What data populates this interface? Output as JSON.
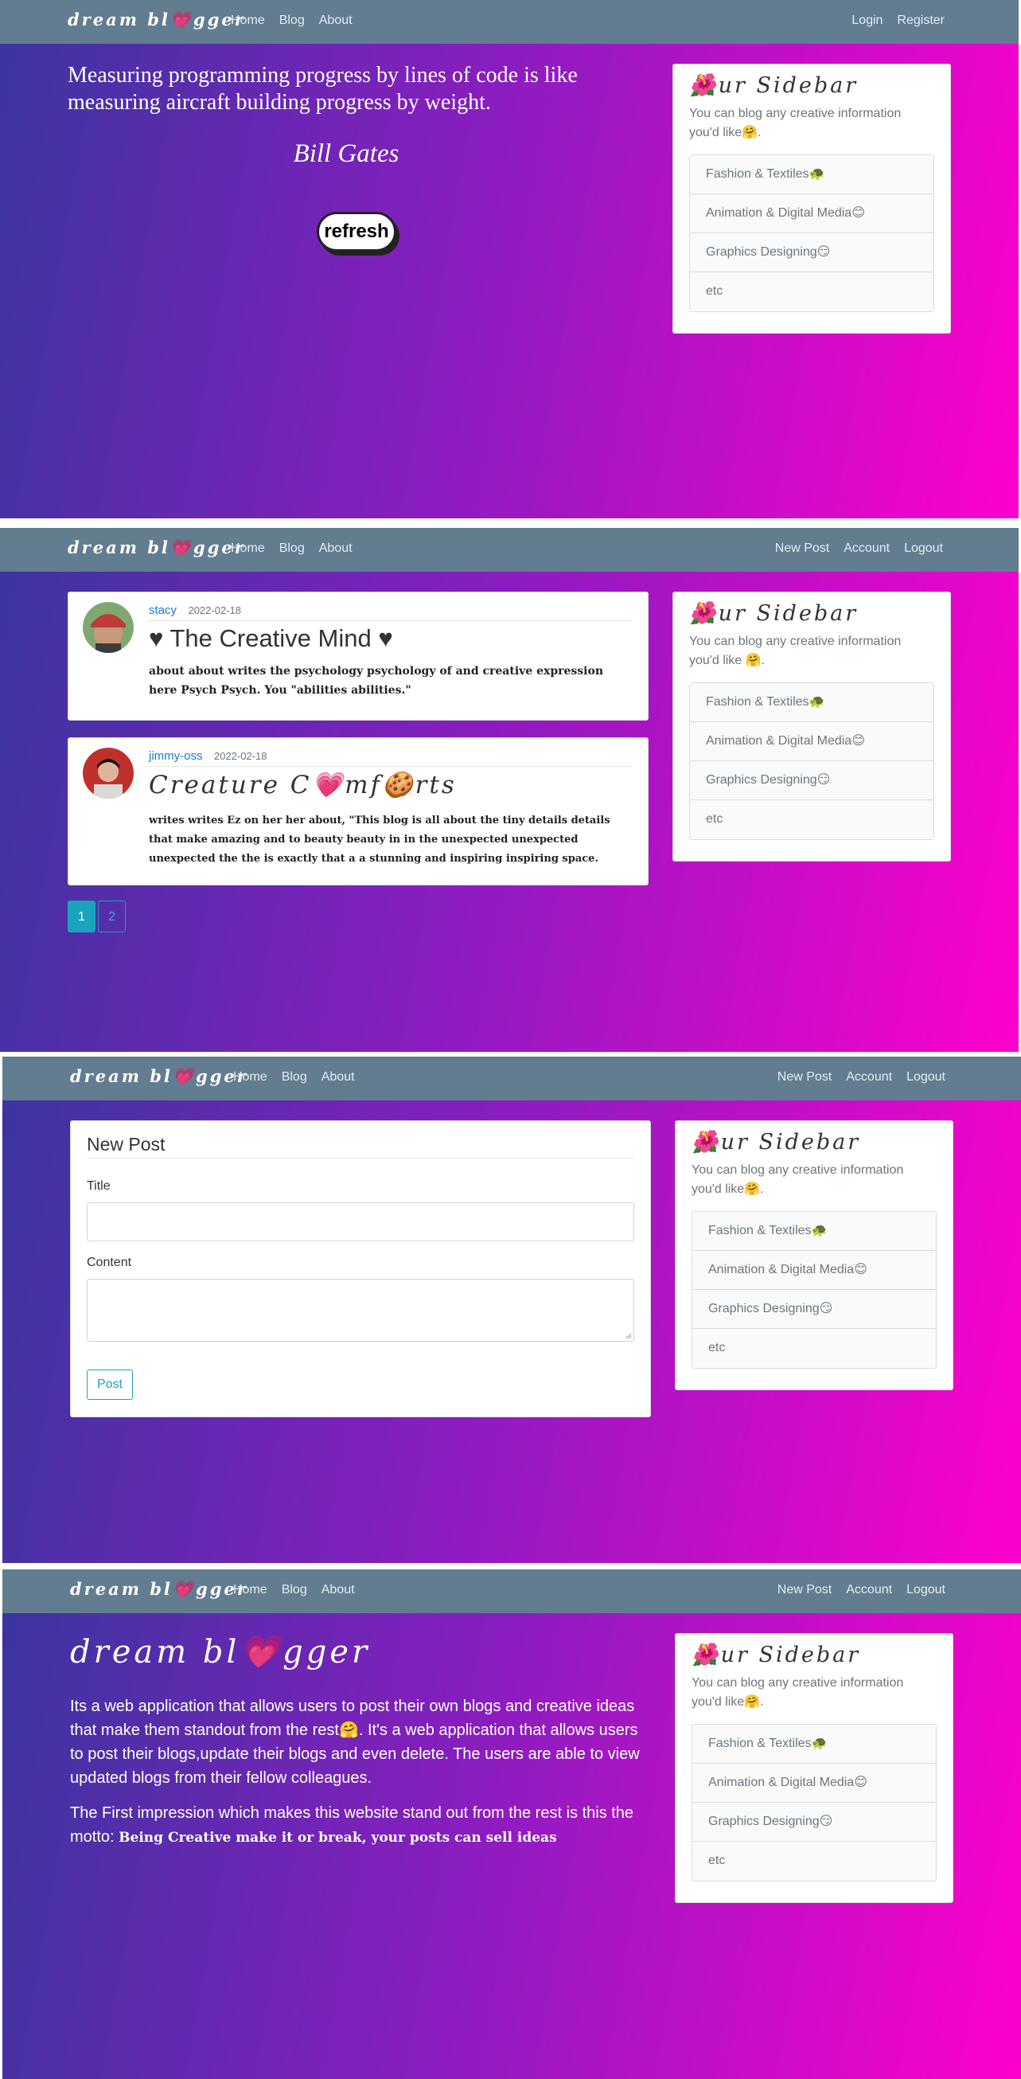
{
  "brand": "dream bl💗gger",
  "nav": {
    "home": "Home",
    "blog": "Blog",
    "about": "About",
    "login": "Login",
    "register": "Register",
    "new_post": "New Post",
    "account": "Account",
    "logout": "Logout"
  },
  "sidebar": {
    "title": "🌺ur Sidebar",
    "text": "You can blog any creative information you'd like🤗.",
    "text_alt": "You can blog any creative information you'd like 🤗.",
    "items": [
      "Fashion & Textiles🐢",
      "Animation & Digital Media😊",
      "Graphics Designing😏",
      "etc"
    ]
  },
  "home": {
    "quote": "Measuring programming progress by lines of code is like measuring aircraft building progress by weight.",
    "author": "Bill Gates",
    "refresh": "refresh"
  },
  "blog": {
    "posts": [
      {
        "author": "stacy",
        "date": "2022-02-18",
        "title": "♥ The Creative Mind ♥",
        "body": "about about writes the psychology psychology of and creative expression here Psych Psych. You \"abilities abilities.\""
      },
      {
        "author": "jimmy-oss",
        "date": "2022-02-18",
        "title": "Creature C💗mf🍪rts",
        "body": "writes writes Ez on her her about, \"This blog is all about the tiny details details that make amazing and to beauty beauty in in the unexpected unexpected unexpected the the is exactly that a a stunning and inspiring inspiring space."
      }
    ],
    "pages": [
      "1",
      "2"
    ]
  },
  "new_post": {
    "legend": "New Post",
    "title_label": "Title",
    "content_label": "Content",
    "submit": "Post"
  },
  "about": {
    "title": "dream bl💗gger",
    "p1": "Its a web application that allows users to post their own blogs and creative ideas that make them standout from the rest🤗. It's a web application that allows users to post their blogs,update their blogs and even delete. The users are able to view updated blogs from their fellow colleagues.",
    "p2_intro": "The First impression which makes this website stand out from the rest is this the motto:",
    "motto": "Being Creative make it or break, your posts can sell ideas"
  }
}
